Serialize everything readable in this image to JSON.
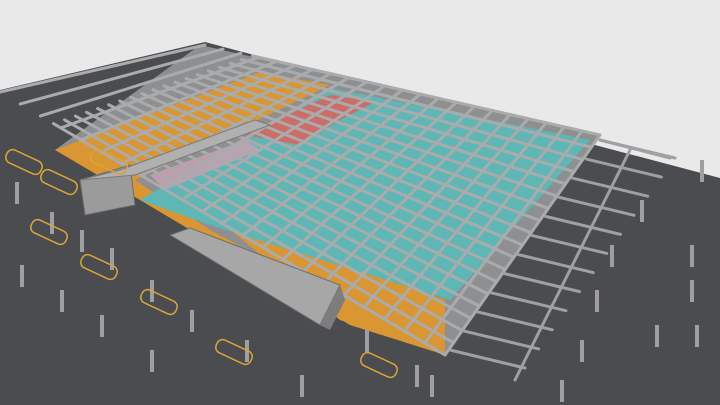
{
  "scene": {
    "description_visible_text": "",
    "colors": {
      "sky": "#e9e9e9",
      "ground": "#4a4c4f",
      "concrete": "#9a9a9a",
      "concrete_dark": "#6f6f6f",
      "deck_grey": "#8c8c8c",
      "teal_zone": "#5fb7b5",
      "orange_zone": "#d99632",
      "red_zone": "#d8655f",
      "pink_zone": "#c9a0b2",
      "parking_line": "#d9a43a",
      "column": "#9f9f9f"
    },
    "zones": [
      "teal",
      "orange",
      "red",
      "pink"
    ]
  }
}
